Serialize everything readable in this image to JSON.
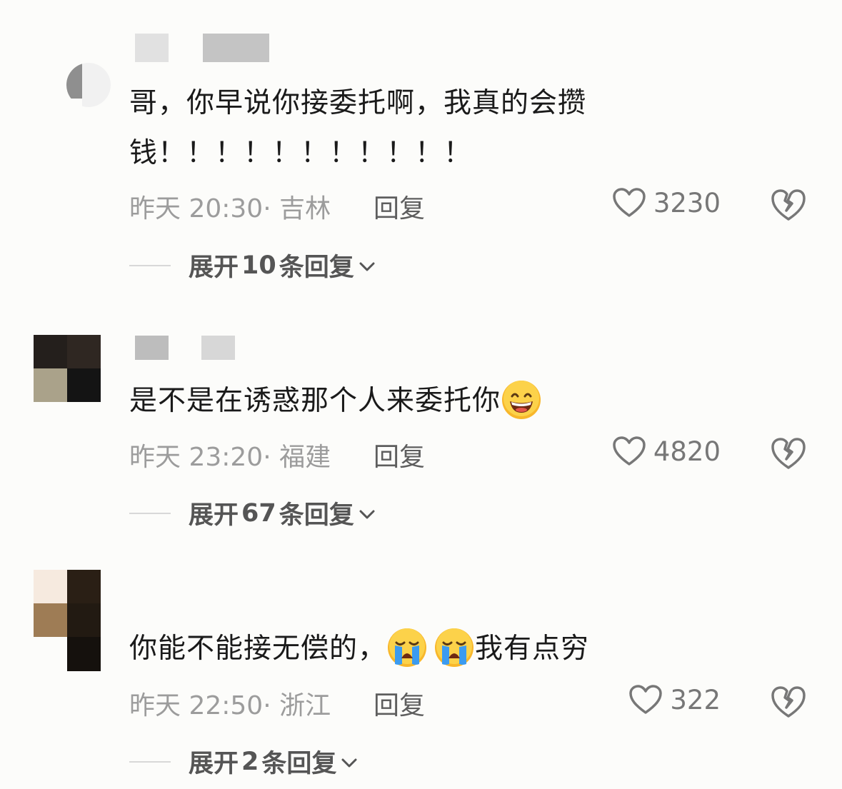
{
  "comments": [
    {
      "avatar_tiles": [
        "#cfcfcf",
        "#e6e6e6",
        "#8e8e8e",
        "#ededed"
      ],
      "text": "哥，你早说你接委托啊，我真的会攒钱！！！！！！！！！！！",
      "emojis": [],
      "time": "昨天 20:30",
      "location": "吉林",
      "reply_label": "回复",
      "likes": "3230",
      "expand": {
        "count": "10",
        "prefix": "展开",
        "suffix": "条回复"
      }
    },
    {
      "avatar_tiles": [
        "#241f1c",
        "#2f2722",
        "#aaa28a",
        "#141414"
      ],
      "text": "是不是在诱惑那个人来委托你",
      "emojis": [
        "grinning-face-emoji"
      ],
      "time": "昨天 23:20",
      "location": "福建",
      "reply_label": "回复",
      "likes": "4820",
      "expand": {
        "count": "67",
        "prefix": "展开",
        "suffix": "条回复"
      }
    },
    {
      "avatar_tiles": [
        "#f6eadf",
        "#2a1f15",
        "#9e7c55",
        "#221a12"
      ],
      "text_before": "你能不能接无偿的，",
      "emojis": [
        "loudly-crying-face-emoji",
        "loudly-crying-face-emoji"
      ],
      "text_after": "我有点穷",
      "time": "昨天 22:50",
      "location": "浙江",
      "reply_label": "回复",
      "likes": "322",
      "expand": {
        "count": "2",
        "prefix": "展开",
        "suffix": "条回复"
      }
    }
  ],
  "colors": {
    "background": "#fcfcfa",
    "text": "#1a1a1a",
    "meta": "#9c9c9c",
    "icon": "#777777"
  }
}
